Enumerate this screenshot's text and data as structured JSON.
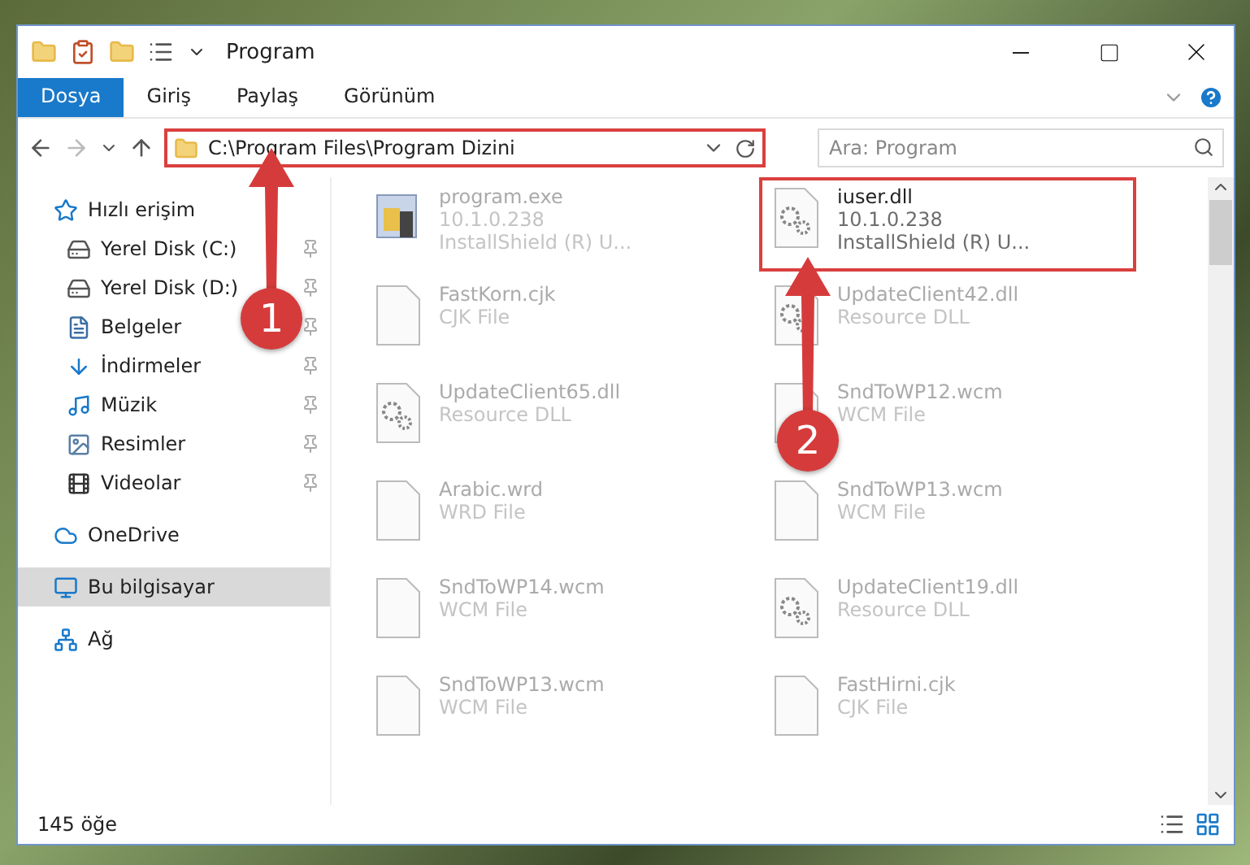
{
  "window": {
    "title": "Program"
  },
  "ribbon_tabs": [
    {
      "label": "Dosya",
      "kind": "file",
      "selected": false
    },
    {
      "label": "Giriş",
      "kind": "tab",
      "selected": false
    },
    {
      "label": "Paylaş",
      "kind": "tab",
      "selected": false
    },
    {
      "label": "Görünüm",
      "kind": "tab",
      "selected": false
    }
  ],
  "address_bar": {
    "path": "C:\\Program Files\\Program Dizini",
    "highlighted": true
  },
  "search": {
    "placeholder": "Ara: Program"
  },
  "sidebar": {
    "items": [
      {
        "label": "Hızlı erişim",
        "kind": "star",
        "selected": false,
        "children": [
          {
            "label": "Yerel Disk (C:)",
            "kind": "drive-c",
            "pinned": true
          },
          {
            "label": "Yerel Disk (D:)",
            "kind": "drive",
            "pinned": true
          },
          {
            "label": "Belgeler",
            "kind": "document",
            "pinned": true
          },
          {
            "label": "İndirmeler",
            "kind": "download",
            "pinned": true
          },
          {
            "label": "Müzik",
            "kind": "music",
            "pinned": true
          },
          {
            "label": "Resimler",
            "kind": "picture",
            "pinned": true
          },
          {
            "label": "Videolar",
            "kind": "video",
            "pinned": true
          }
        ]
      },
      {
        "label": "OneDrive",
        "kind": "cloud",
        "selected": false
      },
      {
        "label": "Bu bilgisayar",
        "kind": "computer",
        "selected": true
      },
      {
        "label": "Ağ",
        "kind": "network",
        "selected": false
      }
    ]
  },
  "files": [
    {
      "name": "program.exe",
      "lines": [
        "10.1.0.238",
        "InstallShield (R) U..."
      ],
      "kind": "app",
      "highlighted": false,
      "blurred": true
    },
    {
      "name": "iuser.dll",
      "lines": [
        "10.1.0.238",
        "InstallShield (R) U..."
      ],
      "kind": "dll",
      "highlighted": true,
      "blurred": false
    },
    {
      "name": "FastKorn.cjk",
      "lines": [
        "CJK File"
      ],
      "kind": "blank",
      "highlighted": false,
      "blurred": true
    },
    {
      "name": "UpdateClient42.dll",
      "lines": [
        "Resource DLL"
      ],
      "kind": "dll",
      "highlighted": false,
      "blurred": true
    },
    {
      "name": "UpdateClient65.dll",
      "lines": [
        "Resource DLL"
      ],
      "kind": "dll",
      "highlighted": false,
      "blurred": true
    },
    {
      "name": "SndToWP12.wcm",
      "lines": [
        "WCM File"
      ],
      "kind": "blank",
      "highlighted": false,
      "blurred": true
    },
    {
      "name": "Arabic.wrd",
      "lines": [
        "WRD File"
      ],
      "kind": "blank",
      "highlighted": false,
      "blurred": true
    },
    {
      "name": "SndToWP13.wcm",
      "lines": [
        "WCM File"
      ],
      "kind": "blank",
      "highlighted": false,
      "blurred": true
    },
    {
      "name": "SndToWP14.wcm",
      "lines": [
        "WCM File"
      ],
      "kind": "blank",
      "highlighted": false,
      "blurred": true
    },
    {
      "name": "UpdateClient19.dll",
      "lines": [
        "Resource DLL"
      ],
      "kind": "dll",
      "highlighted": false,
      "blurred": true
    },
    {
      "name": "SndToWP13.wcm",
      "lines": [
        "WCM File"
      ],
      "kind": "blank",
      "highlighted": false,
      "blurred": true
    },
    {
      "name": "FastHirni.cjk",
      "lines": [
        "CJK File"
      ],
      "kind": "blank",
      "highlighted": false,
      "blurred": true
    }
  ],
  "status_bar": {
    "count": "145 öğe"
  },
  "annotations": [
    {
      "number": "1"
    },
    {
      "number": "2"
    }
  ]
}
